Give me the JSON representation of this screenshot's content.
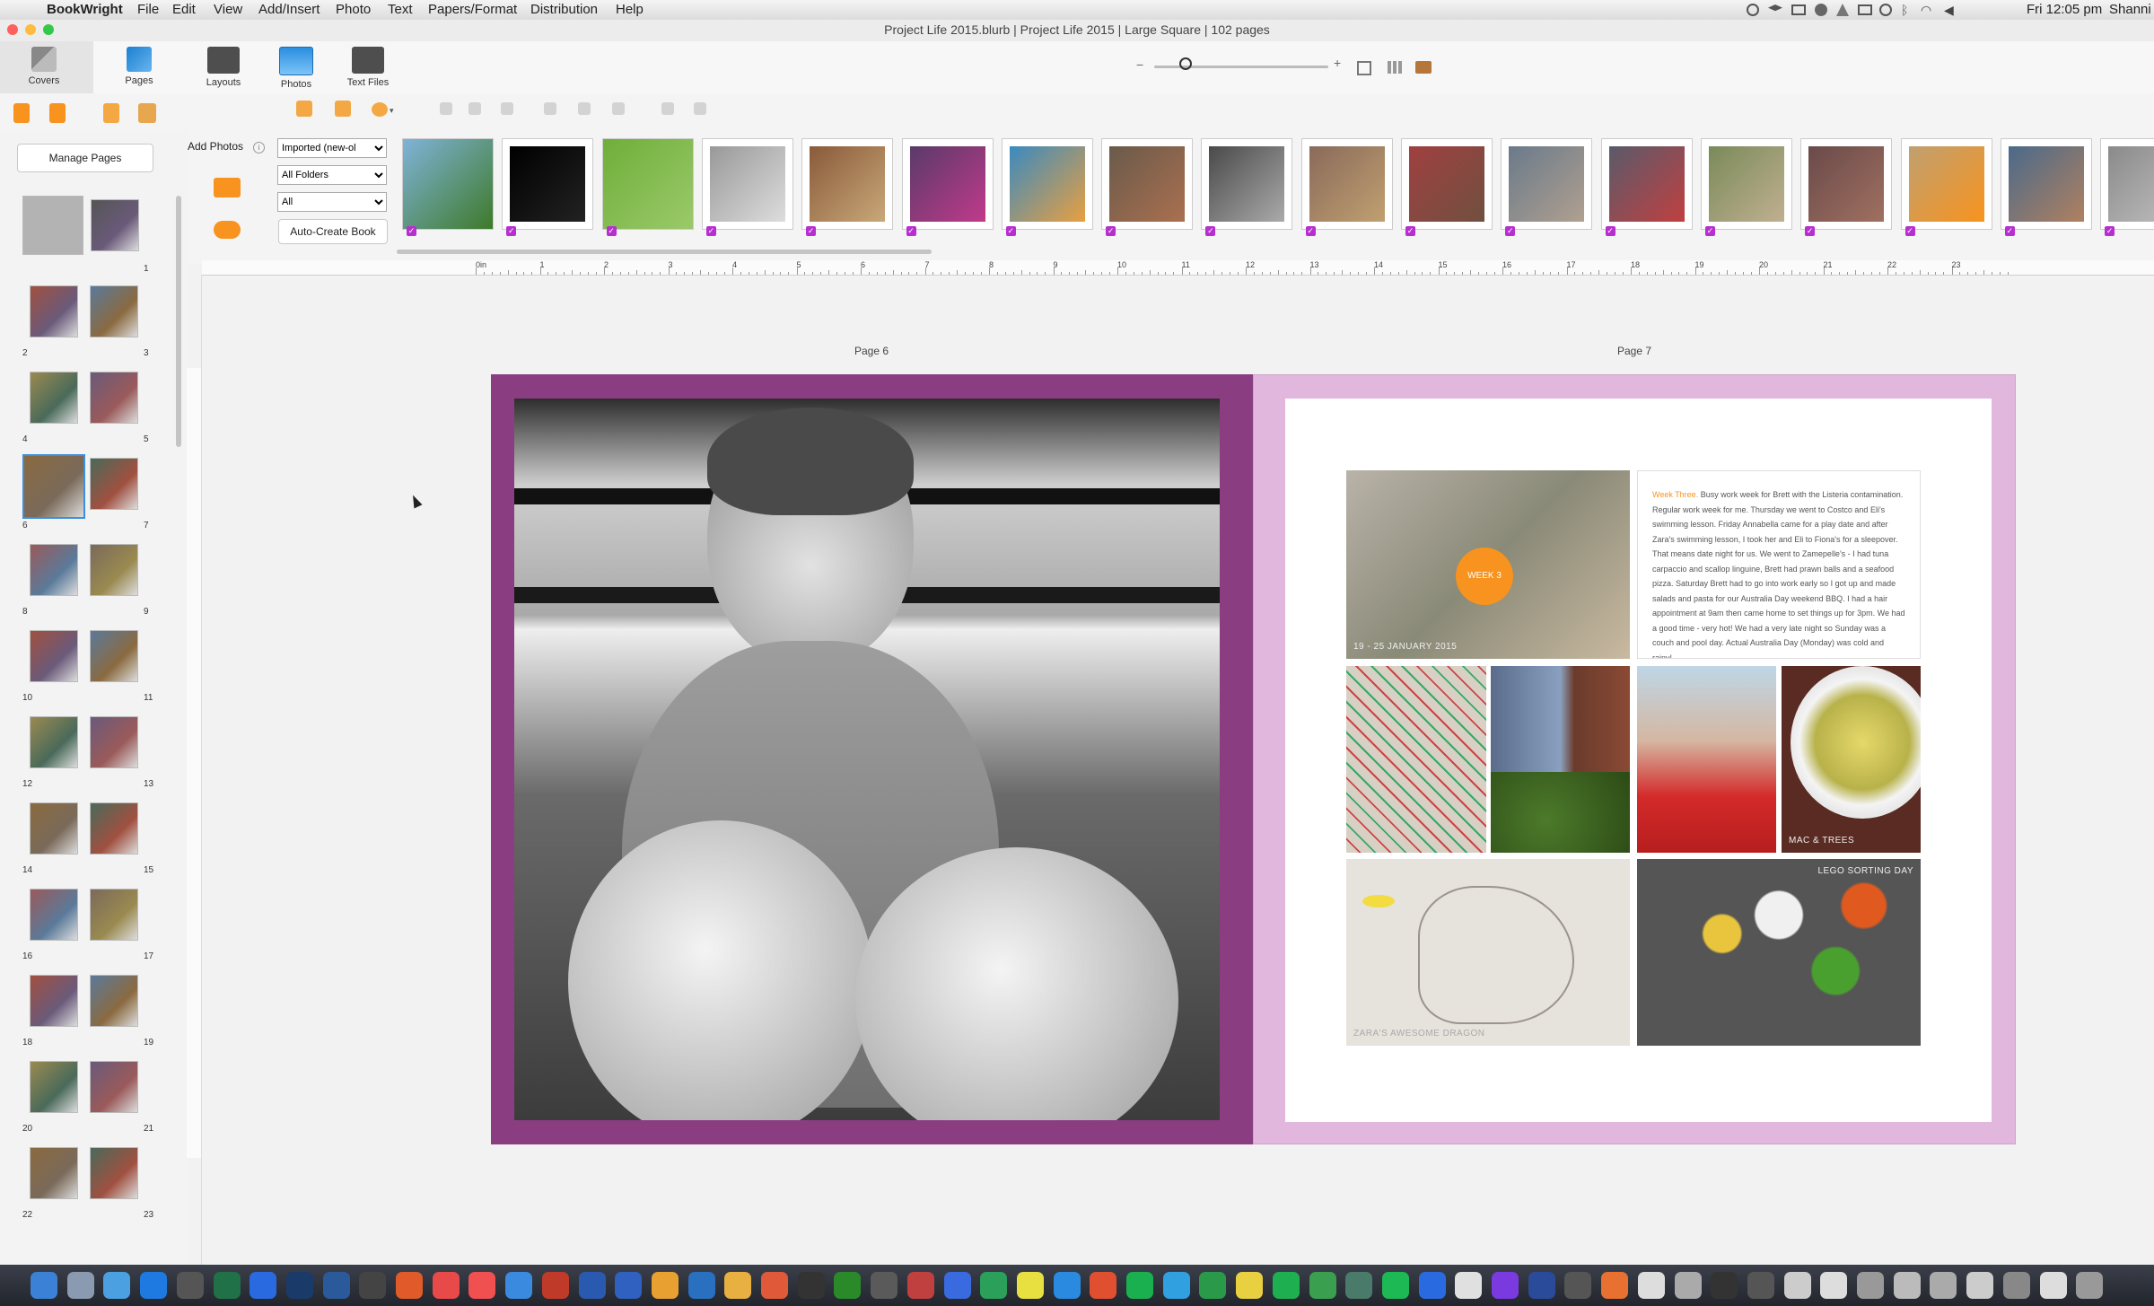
{
  "menubar": {
    "apple": "",
    "app": "BookWright",
    "items": [
      "File",
      "Edit",
      "View",
      "Add/Insert",
      "Photo",
      "Text",
      "Papers/Format",
      "Distribution",
      "Help"
    ],
    "clock": "Fri 12:05 pm",
    "user": "Shanni"
  },
  "window": {
    "title": "Project Life 2015.blurb | Project Life 2015 | Large Square | 102 pages"
  },
  "toolbar": {
    "covers_label": "Covers",
    "pages_label": "Pages",
    "layouts_label": "Layouts",
    "photos_label": "Photos",
    "textfiles_label": "Text Files",
    "zoom_minus": "−",
    "zoom_plus": "+"
  },
  "left_panel": {
    "manage_pages_label": "Manage Pages",
    "page_numbers": [
      "1",
      "2",
      "3",
      "4",
      "5",
      "6",
      "7",
      "8",
      "9",
      "10",
      "11",
      "12",
      "13",
      "14",
      "15",
      "16",
      "17",
      "18",
      "19",
      "20",
      "21",
      "22",
      "23"
    ]
  },
  "photo_tray": {
    "add_photos_label": "Add Photos",
    "filter_sort": "Imported (new-ol",
    "filter_folders": "All Folders",
    "filter_all": "All",
    "auto_create_label": "Auto-Create Book",
    "checkmark": "✓"
  },
  "ruler": {
    "labels": [
      "0in",
      "1",
      "2",
      "3",
      "4",
      "5",
      "6",
      "7",
      "8",
      "9",
      "10",
      "11",
      "12",
      "13",
      "14",
      "15",
      "16",
      "17",
      "18",
      "19",
      "20",
      "21",
      "22",
      "23"
    ]
  },
  "spread": {
    "left_page_label": "Page 6",
    "right_page_label": "Page 7",
    "journal_heading": "Week Three.",
    "journal_text": "Busy work week for Brett with the Listeria contamination. Regular work week for me. Thursday we went to Costco and Eli's swimming lesson. Friday Annabella came for a play date and after Zara's swimming lesson, I took her and Eli to Fiona's for a sleepover. That means date night for us. We went to Zamepelle's - I had tuna carpaccio and scallop linguine, Brett had prawn balls and a seafood pizza. Saturday Brett had to go into work early so I got up and made salads and pasta for our Australia Day weekend BBQ. I had a hair appointment at 9am then came home to set things up for 3pm. We had a good time - very hot! We had a very late night so Sunday was a couch and pool day. Actual Australia Day (Monday) was cold and rainy!",
    "week_badge": "WEEK 3",
    "caption_dates": "19 - 25 JANUARY 2015",
    "caption_mac": "MAC & TREES",
    "caption_dragon": "ZARA'S AWESOME DRAGON",
    "caption_lego": "LEGO SORTING DAY"
  },
  "colors": {
    "accent": "#b62fcf",
    "spread_left_frame": "#8b3d82",
    "spread_right_frame": "#e2b7dd",
    "week_badge": "#f7931e"
  }
}
